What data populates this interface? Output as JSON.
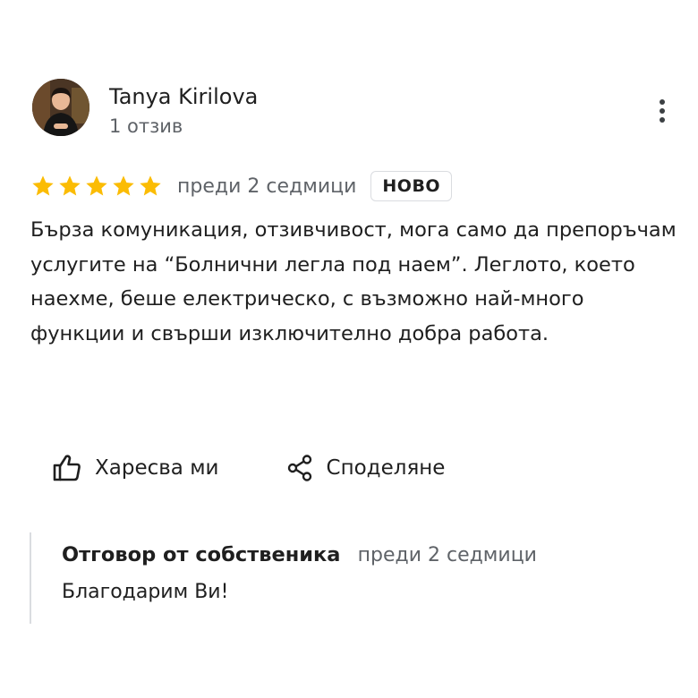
{
  "reviewer": {
    "name": "Tanya Kirilova",
    "review_count": "1 отзив",
    "avatar_icon": "user-photo"
  },
  "menu": {
    "icon": "more-vertical-icon"
  },
  "review": {
    "rating": 5,
    "rating_max": 5,
    "star_color": "#fbbc04",
    "time": "преди 2 седмици",
    "badge": "НОВО",
    "text": "Бърза комуникация,  отзивчивост, мога само да препоръчам услугите на “Болнични легла под наем”. Леглото, което наехме, беше електрическо, с възможно най-много функции и свърши изключително добра работа."
  },
  "actions": {
    "like_label": "Харесва ми",
    "like_icon": "thumbs-up-icon",
    "share_label": "Споделяне",
    "share_icon": "share-icon"
  },
  "owner_reply": {
    "title": "Отговор от собственика",
    "time": "преди 2 седмици",
    "text": "Благодарим Ви!"
  }
}
